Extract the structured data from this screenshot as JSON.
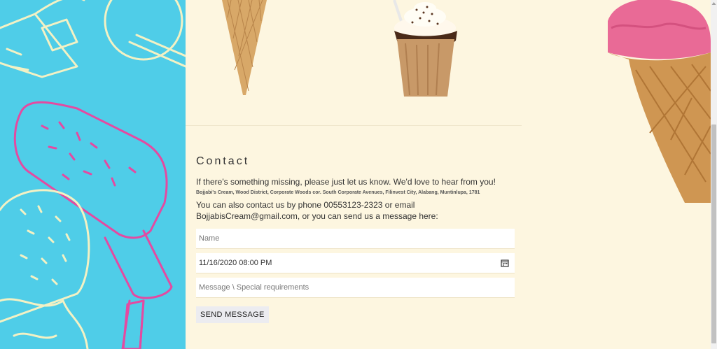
{
  "contact": {
    "heading": "Contact",
    "intro": "If there's something missing, please just let us know. We'd love to hear from you!",
    "address": "Bojjabi's Cream, Wood District, Corporate Woods cor. South Corporate Avenues, Filinvest City, Alabang, Muntinlupa, 1781",
    "phone_text": "You can also contact us by phone 00553123-2323 or email BojjabisCream@gmail.com, or you can send us a message here:"
  },
  "form": {
    "name_placeholder": "Name",
    "datetime_value": "11/16/2020 08:00 PM",
    "message_placeholder": "Message \\ Special requirements",
    "send_label": "SEND MESSAGE"
  },
  "icons": {
    "calendar": "calendar-icon"
  },
  "colors": {
    "left_panel": "#4fcde8",
    "page_bg": "#fdf6e0",
    "pink_accent": "#e44aa1"
  }
}
